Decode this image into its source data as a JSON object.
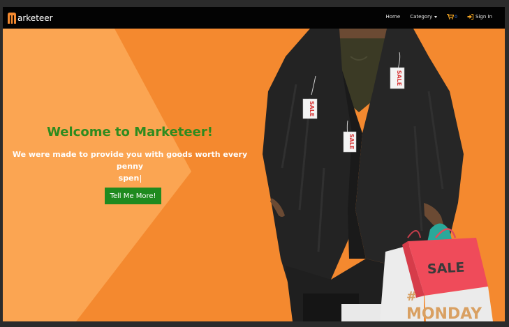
{
  "brand": {
    "logo_letter": "M",
    "name_rest": "arketeer"
  },
  "nav": {
    "home": "Home",
    "category": "Category",
    "cart_count": "0",
    "sign_in": "Sign In"
  },
  "hero": {
    "title": "Welcome to Marketeer!",
    "tagline_line1": "We were made to provide you with goods worth every penny",
    "tagline_line2": "spen",
    "cta": "Tell Me More!",
    "tag_text": "SALE",
    "bag_sale": "SALE",
    "bag_monday": "MONDAY",
    "bag_hash": "#"
  },
  "colors": {
    "accent_orange": "#f4892f",
    "light_orange": "#fba552",
    "title_green": "#2e8b1e",
    "button_green": "#1f8a1f",
    "navbar": "#030303"
  }
}
